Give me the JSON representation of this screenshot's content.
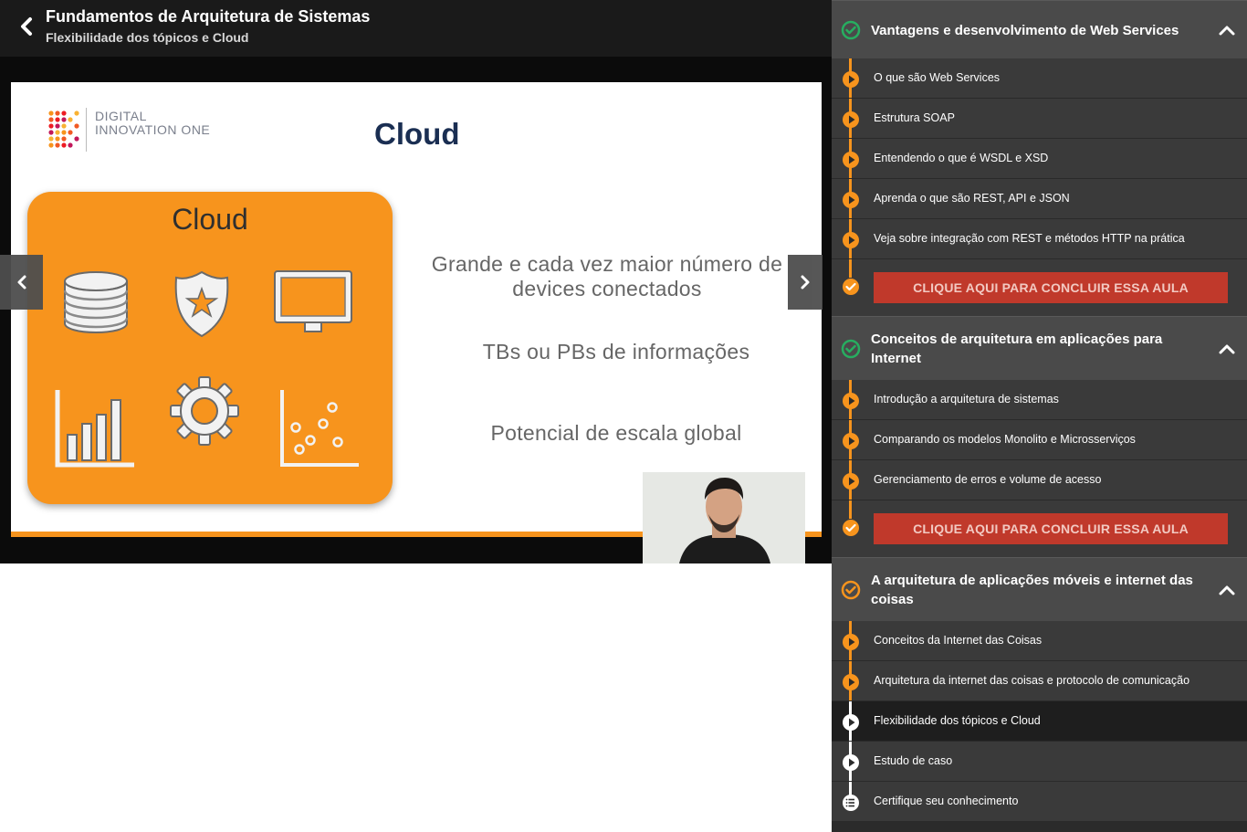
{
  "header": {
    "course_title": "Fundamentos de Arquitetura de Sistemas",
    "lesson_subtitle": "Flexibilidade dos tópicos e Cloud",
    "back_icon": "chevron-left-icon"
  },
  "video": {
    "slide": {
      "logo_text": "DIGITAL INNOVATION ONE",
      "heading": "Cloud",
      "box_title": "Cloud",
      "box_icons": [
        "database-icon",
        "badge-star-icon",
        "monitor-icon",
        "bar-chart-icon",
        "gear-icon",
        "scatter-plot-icon"
      ],
      "text_1": "Grande e cada vez maior número de devices conectados",
      "text_2": "TBs ou PBs de informações",
      "text_3": "Potencial de escala global"
    },
    "prev_icon": "chevron-left-icon",
    "next_icon": "chevron-right-icon"
  },
  "colors": {
    "accent_orange": "#f7941d",
    "complete_green": "#27ae60",
    "conclude_red": "#c0392b",
    "sidebar_bg": "#3a3a3a",
    "section_bg": "#4a4a4a",
    "slide_heading": "#1a2e52"
  },
  "sidebar": {
    "conclude_label": "CLIQUE AQUI PARA CONCLUIR ESSA AULA",
    "sections": [
      {
        "title": "Vantagens e desenvolvimento de Web Services",
        "status": "complete",
        "items": [
          "O que são Web Services",
          "Estrutura SOAP",
          "Entendendo o que é WSDL e XSD",
          "Aprenda o que são REST, API e JSON",
          "Veja sobre integração com REST e métodos HTTP na prática"
        ]
      },
      {
        "title": "Conceitos de arquitetura em aplicações para Internet",
        "status": "complete",
        "items": [
          "Introdução a arquitetura de sistemas",
          "Comparando os modelos Monolito e Microsserviços",
          "Gerenciamento de erros e volume de acesso"
        ]
      },
      {
        "title": "A arquitetura de aplicações móveis e internet das coisas",
        "status": "in-progress",
        "items": [
          "Conceitos da Internet das Coisas",
          "Arquitetura da internet das coisas e protocolo de comunicação",
          "Flexibilidade dos tópicos e Cloud",
          "Estudo de caso",
          "Certifique seu conhecimento"
        ]
      }
    ]
  }
}
